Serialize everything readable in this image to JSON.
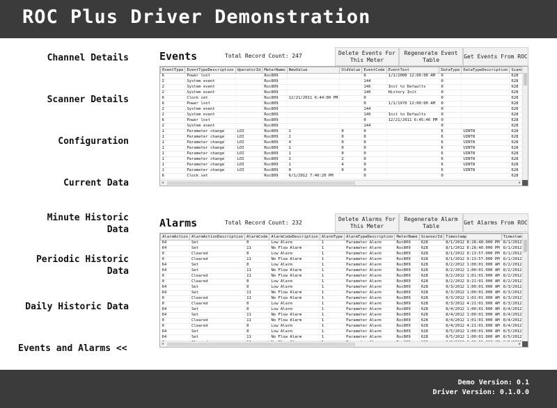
{
  "app": {
    "title": "ROC Plus Driver Demonstration"
  },
  "nav": {
    "channel_details": "Channel Details",
    "scanner_details": "Scanner Details",
    "configuration": "Configuration",
    "current_data": "Current Data",
    "minute_historic_1": "Minute Historic",
    "minute_historic_2": "Data",
    "periodic_historic_1": "Periodic Historic",
    "periodic_historic_2": "Data",
    "daily_historic": "Daily Historic Data",
    "events_alarms": "Events and Alarms <<"
  },
  "events": {
    "title": "Events",
    "record_count": "Total Record Count: 247",
    "buttons": {
      "delete": "Delete Events For\nThis Meter",
      "regenerate": "Regenerate Event\nTable",
      "get": "Get Events From ROC"
    },
    "columns": [
      "EventType",
      "EventTypeDescription",
      "OperatorId",
      "MeterName",
      "NewValue",
      "OldValue",
      "EventCode",
      "EventText",
      "DataType",
      "DataTypeDescription",
      "Scanner"
    ],
    "rows": [
      [
        "6",
        "Power lost",
        "",
        "Roc809",
        "",
        "",
        "0",
        "1/1/2000 12:00:00 AM",
        "0",
        "",
        "628"
      ],
      [
        "2",
        "System event",
        "",
        "Roc809",
        "",
        "",
        "144",
        "",
        "0",
        "",
        "628"
      ],
      [
        "2",
        "System event",
        "",
        "Roc809",
        "",
        "",
        "146",
        "Init to Defaults",
        "0",
        "",
        "628"
      ],
      [
        "2",
        "System event",
        "",
        "Roc809",
        "",
        "",
        "140",
        "History Init",
        "0",
        "",
        "628"
      ],
      [
        "6",
        "Clock set",
        "",
        "Roc809",
        "12/21/2011 6:44:00 PM",
        "",
        "0",
        "",
        "0",
        "",
        "628"
      ],
      [
        "6",
        "Power lost",
        "",
        "Roc809",
        "",
        "",
        "0",
        "1/1/1970 12:00:00 AM",
        "0",
        "",
        "628"
      ],
      [
        "2",
        "System event",
        "",
        "Roc809",
        "",
        "",
        "144",
        "",
        "0",
        "",
        "628"
      ],
      [
        "2",
        "System event",
        "",
        "Roc809",
        "",
        "",
        "146",
        "Init to Defaults",
        "0",
        "",
        "628"
      ],
      [
        "6",
        "Power lost",
        "",
        "Roc809",
        "",
        "",
        "0",
        "12/21/2011 6:45:46 PM",
        "0",
        "",
        "628"
      ],
      [
        "2",
        "System event",
        "",
        "Roc809",
        "",
        "",
        "144",
        "",
        "0",
        "",
        "628"
      ],
      [
        "1",
        "Parameter change",
        "LOI",
        "Roc809",
        "1",
        "0",
        "0",
        "",
        "6",
        "UINT8",
        "628"
      ],
      [
        "1",
        "Parameter change",
        "LOI",
        "Roc809",
        "2",
        "0",
        "0",
        "",
        "6",
        "UINT8",
        "628"
      ],
      [
        "1",
        "Parameter change",
        "LOI",
        "Roc809",
        "4",
        "0",
        "0",
        "",
        "6",
        "UINT8",
        "628"
      ],
      [
        "1",
        "Parameter change",
        "LOI",
        "Roc809",
        "1",
        "0",
        "0",
        "",
        "6",
        "UINT8",
        "628"
      ],
      [
        "1",
        "Parameter change",
        "LOI",
        "Roc809",
        "1",
        "0",
        "0",
        "",
        "6",
        "UINT8",
        "628"
      ],
      [
        "1",
        "Parameter change",
        "LOI",
        "Roc809",
        "1",
        "2",
        "0",
        "",
        "6",
        "UINT8",
        "628"
      ],
      [
        "1",
        "Parameter change",
        "LOI",
        "Roc809",
        "1",
        "4",
        "0",
        "",
        "6",
        "UINT8",
        "628"
      ],
      [
        "1",
        "Parameter change",
        "LOI",
        "Roc809",
        "8",
        "0",
        "0",
        "",
        "6",
        "UINT8",
        "628"
      ],
      [
        "6",
        "Clock set",
        "",
        "Roc809",
        "6/1/2012 7:40:20 PM",
        "",
        "0",
        "",
        "0",
        "",
        "628"
      ]
    ]
  },
  "alarms": {
    "title": "Alarms",
    "record_count": "Total Record Count: 232",
    "buttons": {
      "delete": "Delete Alarms For\nThis Meter",
      "regenerate": "Regenerate Alarm\nTable",
      "get": "Get Alarms From ROC"
    },
    "columns": [
      "AlarmAction",
      "AlarmActionDescription",
      "AlarmCode",
      "AlarmCodeDescription",
      "AlarmType",
      "AlarmTypeDescription",
      "MeterName",
      "ScannerId",
      "Timestamp",
      "TimestampString"
    ],
    "rows": [
      [
        "64",
        "Set",
        "0",
        "Low Alarm",
        "1",
        "Parameter Alarm",
        "Roc809",
        "628",
        "8/1/2012 8:28:40.000 PM",
        "8/1/2012 7:28:4"
      ],
      [
        "64",
        "Set",
        "11",
        "No Flow Alarm",
        "1",
        "Parameter Alarm",
        "Roc809",
        "628",
        "8/1/2012 8:28:40.000 PM",
        "8/1/2012 7:28:4"
      ],
      [
        "0",
        "Cleared",
        "0",
        "Low Alarm",
        "1",
        "Parameter Alarm",
        "Roc809",
        "628",
        "8/1/2012 9:13:57.000 PM",
        "8/1/2012 8:13:5"
      ],
      [
        "0",
        "Cleared",
        "11",
        "No Flow Alarm",
        "1",
        "Parameter Alarm",
        "Roc809",
        "628",
        "8/1/2012 9:13:57.000 PM",
        "8/1/2012 8:13:5"
      ],
      [
        "64",
        "Set",
        "0",
        "Low Alarm",
        "1",
        "Parameter Alarm",
        "Roc809",
        "628",
        "8/2/2012 1:00:01.000 AM",
        "8/2/2012 12:00:"
      ],
      [
        "64",
        "Set",
        "11",
        "No Flow Alarm",
        "1",
        "Parameter Alarm",
        "Roc809",
        "628",
        "8/2/2012 1:00:01.000 AM",
        "8/2/2012 12:00:"
      ],
      [
        "0",
        "Cleared",
        "11",
        "No Flow Alarm",
        "1",
        "Parameter Alarm",
        "Roc809",
        "628",
        "8/2/2012 1:01:01.000 AM",
        "8/2/2012 12:01:"
      ],
      [
        "0",
        "Cleared",
        "0",
        "Low Alarm",
        "1",
        "Parameter Alarm",
        "Roc809",
        "628",
        "8/2/2012 9:21:01.000 AM",
        "8/2/2012 8:21:0"
      ],
      [
        "64",
        "Set",
        "0",
        "Low Alarm",
        "1",
        "Parameter Alarm",
        "Roc809",
        "628",
        "8/3/2012 1:00:01.000 AM",
        "8/3/2012 12:00:"
      ],
      [
        "64",
        "Set",
        "11",
        "No Flow Alarm",
        "1",
        "Parameter Alarm",
        "Roc809",
        "628",
        "8/3/2012 1:00:01.000 AM",
        "8/3/2012 12:00:"
      ],
      [
        "0",
        "Cleared",
        "11",
        "No Flow Alarm",
        "1",
        "Parameter Alarm",
        "Roc809",
        "628",
        "8/3/2012 1:01:01.000 AM",
        "8/3/2012 12:01:"
      ],
      [
        "0",
        "Cleared",
        "0",
        "Low Alarm",
        "1",
        "Parameter Alarm",
        "Roc809",
        "628",
        "8/3/2012 4:21:01.000 AM",
        "8/3/2012 3:21:0"
      ],
      [
        "64",
        "Set",
        "0",
        "Low Alarm",
        "1",
        "Parameter Alarm",
        "Roc809",
        "628",
        "8/4/2012 1:00:01.000 AM",
        "8/4/2012 12:00:"
      ],
      [
        "64",
        "Set",
        "11",
        "No Flow Alarm",
        "1",
        "Parameter Alarm",
        "Roc809",
        "628",
        "8/4/2012 1:00:01.000 AM",
        "8/4/2012 12:00:"
      ],
      [
        "0",
        "Cleared",
        "11",
        "No Flow Alarm",
        "1",
        "Parameter Alarm",
        "Roc809",
        "628",
        "8/4/2012 1:01:01.000 AM",
        "8/4/2012 12:01:"
      ],
      [
        "0",
        "Cleared",
        "0",
        "Low Alarm",
        "1",
        "Parameter Alarm",
        "Roc809",
        "628",
        "8/4/2012 4:21:01.000 AM",
        "8/4/2012 3:21:0"
      ],
      [
        "64",
        "Set",
        "0",
        "Low Alarm",
        "1",
        "Parameter Alarm",
        "Roc809",
        "628",
        "8/5/2012 1:00:01.000 AM",
        "8/5/2012 12:00:"
      ],
      [
        "64",
        "Set",
        "11",
        "No Flow Alarm",
        "1",
        "Parameter Alarm",
        "Roc809",
        "628",
        "8/5/2012 1:00:01.000 AM",
        "8/5/2012 12:00:"
      ],
      [
        "0",
        "Cleared",
        "11",
        "No Flow Alarm",
        "1",
        "Parameter Alarm",
        "Roc809",
        "628",
        "8/5/2012 1:01:01.000 AM",
        "8/5/2012 12:01:"
      ]
    ]
  },
  "footer": {
    "demo_version": "Demo Version: 0.1",
    "driver_version": "Driver Version: 0.1.0.0"
  }
}
